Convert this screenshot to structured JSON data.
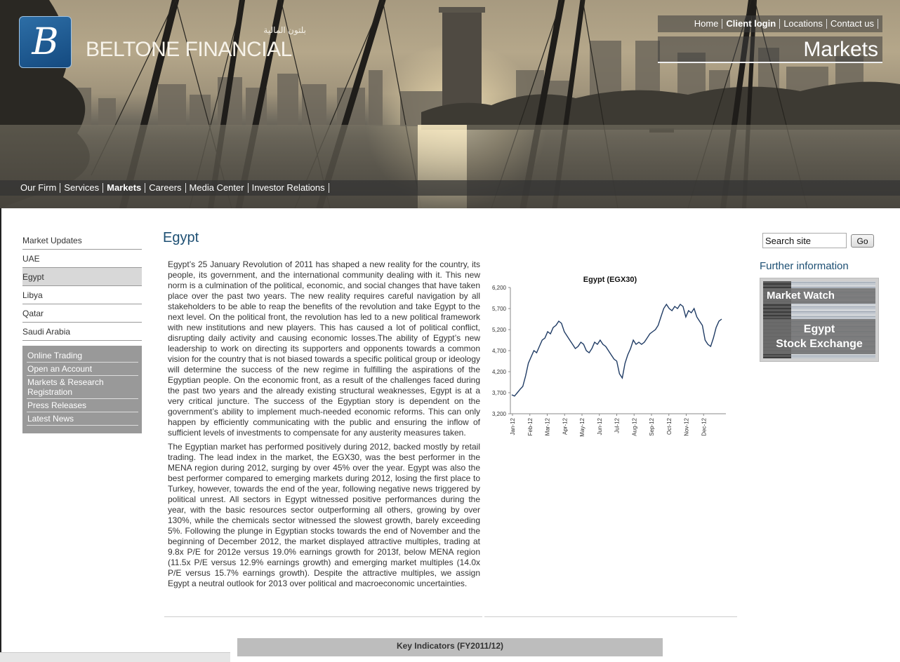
{
  "header": {
    "logo_letter": "B",
    "logo_arabic": "بلتون المالية",
    "logo_text": "BELTONE FINANCIAL",
    "top_links": [
      "Home",
      "Client login",
      "Locations",
      "Contact us"
    ],
    "section_title": "Markets"
  },
  "main_nav": [
    "Our Firm",
    "Services",
    "Markets",
    "Careers",
    "Media Center",
    "Investor Relations"
  ],
  "left_nav": [
    "Market Updates",
    "UAE",
    "Egypt",
    "Libya",
    "Qatar",
    "Saudi Arabia"
  ],
  "quick_links": [
    "Online Trading",
    "Open an Account",
    "Markets & Research Registration",
    "Press Releases",
    "Latest News"
  ],
  "page_title": "Egypt",
  "article": {
    "p1": "Egypt’s 25 January Revolution of 2011 has shaped a new reality for the country, its people, its government, and the international community dealing with it. This new norm is a culmination of the political, economic, and social changes that have taken place over the past two years. The new reality requires careful navigation by all stakeholders to be able to reap the benefits of the revolution and take Egypt to the next level. On the political front, the revolution has led to a new political framework with new institutions and new players. This has caused a lot of political conflict, disrupting daily activity and causing economic losses.The ability of Egypt’s new leadership to work on directing its supporters and opponents towards a common vision for the country that is not biased towards a specific political group or ideology will determine the success of the new regime in fulfilling the aspirations of the Egyptian people. On the economic front, as a result of the challenges faced during the past two years and the already existing structural weaknesses, Egypt is at a very critical juncture. The success of the Egyptian story is dependent on the government’s ability to implement much-needed economic reforms. This can only happen by efficiently communicating with the public and ensuring the inflow of sufficient levels of investments to compensate for any austerity measures taken.",
    "p2": "The Egyptian market has performed positively during 2012, backed mostly by retail trading. The lead index in the market, the EGX30, was the best performer in the MENA region during 2012, surging by over 45% over the year. Egypt was also the best performer compared to emerging markets during 2012, losing the first place to Turkey, however, towards the end of the year, following negative news triggered by political unrest. All sectors in Egypt witnessed positive performances during the year, with the basic resources sector outperforming all others, growing by over 130%, while the chemicals sector witnessed the slowest growth, barely exceeding 5%. Following the plunge in Egyptian stocks towards the end of November and the beginning of December 2012, the market displayed attractive multiples, trading at 9.8x P/E for 2012e versus 19.0% earnings growth for 2013f, below MENA region (11.5x P/E versus 12.9% earnings growth) and emerging market multiples (14.0x P/E versus 15.7% earnings growth). Despite the attractive multiples, we assign Egypt a neutral outlook for 2013 over political and macroeconomic uncertainties."
  },
  "key_indicators_title": "Key Indicators (FY2011/12)",
  "search": {
    "value": "Search site",
    "button": "Go"
  },
  "further_information": {
    "title": "Further information",
    "banner_line1": "Market Watch",
    "banner_line2": "Egypt",
    "banner_line3": "Stock Exchange"
  },
  "colors": {
    "title_blue": "#1d4f73",
    "line_navy": "#1f3b64",
    "sidebar_grey": "#999999"
  },
  "chart_data": {
    "type": "line",
    "title": "Egypt (EGX30)",
    "xlabel": "",
    "ylabel": "",
    "ylim": [
      3200,
      6200
    ],
    "yticks": [
      "6,200",
      "5,700",
      "5,200",
      "4,700",
      "4,200",
      "3,700",
      "3,200"
    ],
    "ytick_values": [
      6200,
      5700,
      5200,
      4700,
      4200,
      3700,
      3200
    ],
    "xticks": [
      "Jan-12",
      "Feb-12",
      "Mar-12",
      "Apr-12",
      "May-12",
      "Jun-12",
      "Jul-12",
      "Aug-12",
      "Sep-12",
      "Oct-12",
      "Nov-12",
      "Dec-12"
    ],
    "series": [
      {
        "values": [
          3650,
          3620,
          3700,
          3780,
          3850,
          4100,
          4400,
          4550,
          4700,
          4650,
          4800,
          4950,
          5000,
          5150,
          5100,
          5250,
          5300,
          5400,
          5350,
          5150,
          5050,
          4950,
          4850,
          4750,
          4800,
          4900,
          4850,
          4700,
          4650,
          4750,
          4900,
          4850,
          4950,
          4850,
          4800,
          4700,
          4600,
          4500,
          4450,
          4150,
          4050,
          4400,
          4600,
          4750,
          4950,
          4850,
          4900,
          4850,
          4900,
          5000,
          5100,
          5150,
          5200,
          5300,
          5500,
          5700,
          5800,
          5700,
          5650,
          5750,
          5700,
          5800,
          5750,
          5500,
          5650,
          5600,
          5700,
          5500,
          5400,
          5300,
          4950,
          4850,
          4800,
          5000,
          5250,
          5400,
          5450
        ]
      }
    ]
  }
}
